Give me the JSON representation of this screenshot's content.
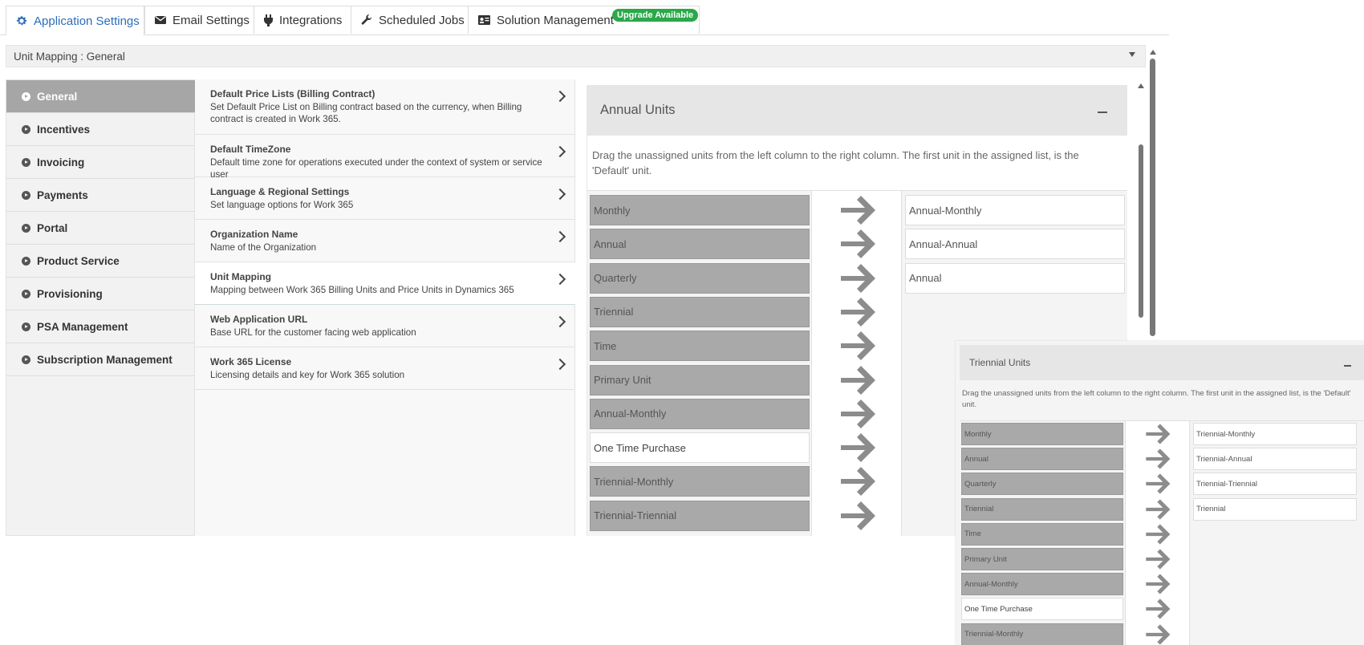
{
  "tabs": [
    {
      "label": "Application Settings",
      "icon": "gear-icon",
      "active": true
    },
    {
      "label": "Email Settings",
      "icon": "envelope-icon"
    },
    {
      "label": "Integrations",
      "icon": "plug-icon"
    },
    {
      "label": "Scheduled Jobs",
      "icon": "wrench-icon"
    },
    {
      "label": "Solution Management",
      "icon": "id-card-icon",
      "badge": "Upgrade Available"
    }
  ],
  "dropdown": {
    "value": "Unit Mapping : General"
  },
  "nav": {
    "items": [
      {
        "label": "General",
        "active": true
      },
      {
        "label": "Incentives"
      },
      {
        "label": "Invoicing"
      },
      {
        "label": "Payments"
      },
      {
        "label": "Portal"
      },
      {
        "label": "Product Service"
      },
      {
        "label": "Provisioning"
      },
      {
        "label": "PSA Management"
      },
      {
        "label": "Subscription Management"
      }
    ]
  },
  "settings": [
    {
      "title": "Default Price Lists (Billing Contract)",
      "desc": "Set Default Price List on Billing contract based on the currency, when Billing contract is created in Work 365."
    },
    {
      "title": "Default TimeZone",
      "desc": "Default time zone for operations executed under the context of system or service user"
    },
    {
      "title": "Language & Regional Settings",
      "desc": "Set language options for Work 365"
    },
    {
      "title": "Organization Name",
      "desc": "Name of the Organization"
    },
    {
      "title": "Unit Mapping",
      "desc": "Mapping between Work 365 Billing Units and Price Units in Dynamics 365",
      "active": true
    },
    {
      "title": "Web Application URL",
      "desc": "Base URL for the customer facing web application"
    },
    {
      "title": "Work 365 License",
      "desc": "Licensing details and key for Work 365 solution"
    }
  ],
  "annual_panel": {
    "title": "Annual Units",
    "description": "Drag the unassigned units from the left column to the right column. The first unit in the assigned list, is the 'Default' unit.",
    "unassigned": [
      "Monthly",
      "Annual",
      "Quarterly",
      "Triennial",
      "Time",
      "Primary Unit",
      "Annual-Monthly",
      "One Time Purchase",
      "Triennial-Monthly",
      "Triennial-Triennial"
    ],
    "assigned": [
      "Annual-Monthly",
      "Annual-Annual",
      "Annual"
    ],
    "highlight": "One Time Purchase"
  },
  "triennial_panel": {
    "title": "Triennial Units",
    "description": "Drag the unassigned units from the left column to the right column. The first unit in the assigned list, is the 'Default' unit.",
    "unassigned": [
      "Monthly",
      "Annual",
      "Quarterly",
      "Triennial",
      "Time",
      "Primary Unit",
      "Annual-Monthly",
      "One Time Purchase",
      "Triennial-Monthly"
    ],
    "assigned": [
      "Triennial-Monthly",
      "Triennial-Annual",
      "Triennial-Triennial",
      "Triennial"
    ],
    "highlight": "One Time Purchase"
  },
  "colors": {
    "accent": "#2a6ebb",
    "badge": "#2aa84a",
    "unit_gray": "#a9a9a9",
    "arrow": "#8c8c8c"
  }
}
